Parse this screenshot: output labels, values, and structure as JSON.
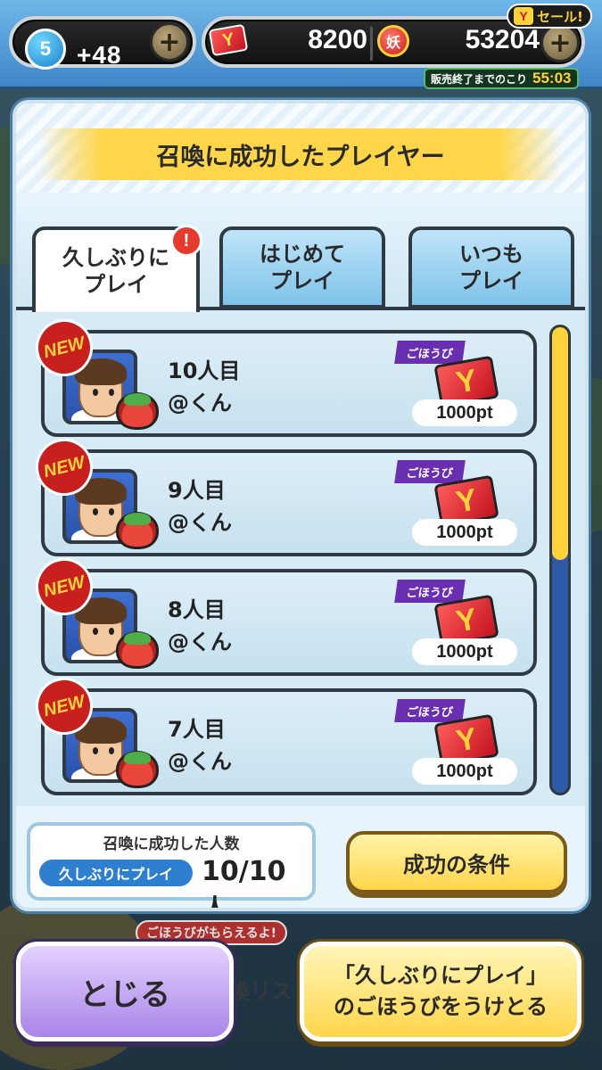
{
  "header": {
    "level": "5",
    "level_bonus": "+48",
    "ticket_value": "8200",
    "coin_value": "53204",
    "sale_label": "セール!",
    "sale_ticket_glyph": "Y",
    "coin_glyph": "妖",
    "sale_timer_label": "販売終了までのこり",
    "sale_timer": "55:03"
  },
  "dialog": {
    "title": "召喚に成功したプレイヤー",
    "tabs": [
      {
        "label": "久しぶりに\nプレイ",
        "active": true,
        "alert": "!"
      },
      {
        "label": "はじめて\nプレイ",
        "active": false
      },
      {
        "label": "いつも\nプレイ",
        "active": false
      }
    ],
    "players": [
      {
        "badge": "NEW",
        "order": "10人目",
        "name": "@くん",
        "reward_label": "ごほうび",
        "reward_glyph": "Y",
        "reward_points": "1000pt"
      },
      {
        "badge": "NEW",
        "order": "9人目",
        "name": "@くん",
        "reward_label": "ごほうび",
        "reward_glyph": "Y",
        "reward_points": "1000pt"
      },
      {
        "badge": "NEW",
        "order": "8人目",
        "name": "@くん",
        "reward_label": "ごほうび",
        "reward_glyph": "Y",
        "reward_points": "1000pt"
      },
      {
        "badge": "NEW",
        "order": "7人目",
        "name": "@くん",
        "reward_label": "ごほうび",
        "reward_glyph": "Y",
        "reward_points": "1000pt"
      }
    ],
    "scroll_position_fraction": 0.5,
    "count_title": "召喚に成功した人数",
    "count_category": "久しぶりにプレイ",
    "count_value": "10/10人",
    "conditions_button": "成功の条件"
  },
  "bottom": {
    "hint_banner": "ごほうびがもらえるよ!",
    "behind_text": "喚リス",
    "close_button": "とじる",
    "claim_button": "「久しぶりにプレイ」\nのごほうびをうけとる"
  },
  "colors": {
    "accent_yellow": "#ffd64a",
    "tab_blue": "#7fc3ea",
    "close_purple": "#a984e8",
    "reward_purple": "#6a2fb0",
    "new_red": "#c81f1f"
  },
  "icons": [
    "level-badge-icon",
    "plus-icon",
    "ticket-icon",
    "coin-icon",
    "new-badge-icon",
    "player-avatar-icon",
    "monster-icon",
    "reward-ticket-icon"
  ]
}
